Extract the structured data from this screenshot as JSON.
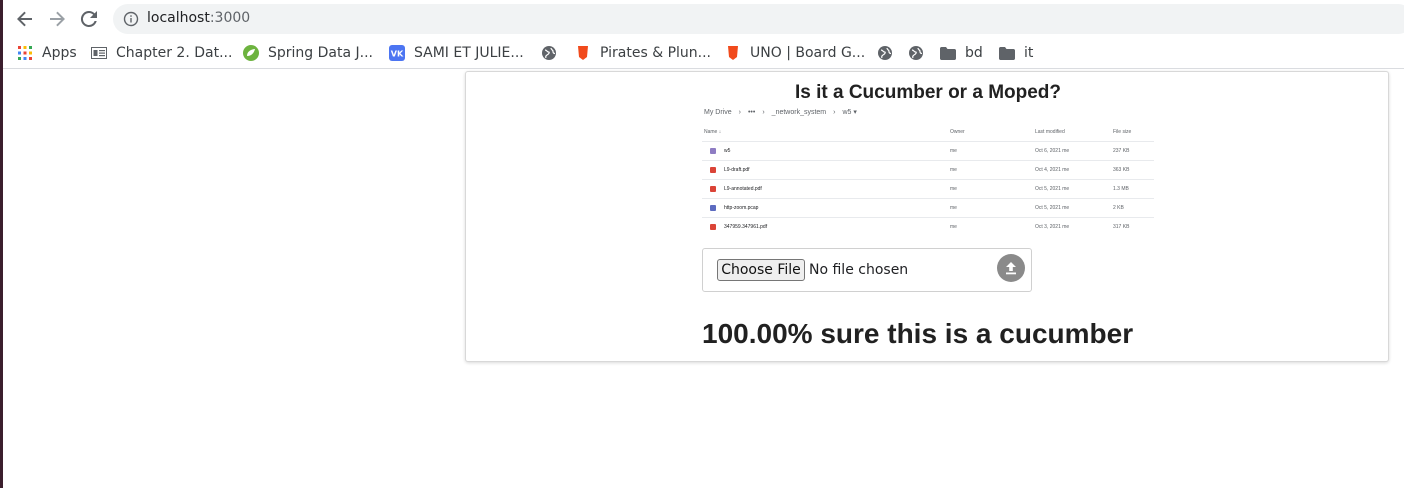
{
  "browser": {
    "url_host": "localhost",
    "url_port": ":3000"
  },
  "bookmarks": [
    {
      "label": "Apps",
      "icon": "apps-grid-icon"
    },
    {
      "label": "Chapter 2. Dat...",
      "icon": "reader-icon"
    },
    {
      "label": "Spring Data J...",
      "icon": "spring-leaf-icon"
    },
    {
      "label": "SAMI ET JULIE...",
      "icon": "vk-icon"
    },
    {
      "label": "",
      "icon": "globe-icon"
    },
    {
      "label": "Pirates & Plun...",
      "icon": "shield-orange-icon"
    },
    {
      "label": "UNO | Board G...",
      "icon": "shield-orange-icon"
    },
    {
      "label": "",
      "icon": "globe-icon"
    },
    {
      "label": "",
      "icon": "globe-icon"
    },
    {
      "label": "bd",
      "icon": "folder-icon"
    },
    {
      "label": "it",
      "icon": "folder-icon"
    }
  ],
  "card": {
    "title": "Is it a Cucumber or a Moped?",
    "result": "100.00% sure this is a cucumber"
  },
  "preview": {
    "breadcrumb": [
      "My Drive",
      "›",
      "•••",
      "›",
      "_network_system",
      "›",
      "w5 ▾"
    ],
    "headers": {
      "name": "Name ↓",
      "owner": "Owner",
      "modified": "Last modified",
      "size": "File size"
    },
    "rows": [
      {
        "name": "w5",
        "owner": "me",
        "modified": "Oct 6, 2021 me",
        "size": "237 KB",
        "color": "#8e7cc3"
      },
      {
        "name": "L9-draft.pdf",
        "owner": "me",
        "modified": "Oct 4, 2021 me",
        "size": "363 KB",
        "color": "#db4437"
      },
      {
        "name": "L9-annotated.pdf",
        "owner": "me",
        "modified": "Oct 5, 2021 me",
        "size": "1.3 MB",
        "color": "#db4437"
      },
      {
        "name": "http-zoom.pcap",
        "owner": "me",
        "modified": "Oct 5, 2021 me",
        "size": "2 KB",
        "color": "#5c6bc0"
      },
      {
        "name": "347959.347961.pdf",
        "owner": "me",
        "modified": "Oct 3, 2021 me",
        "size": "317 KB",
        "color": "#db4437"
      }
    ]
  },
  "upload": {
    "choose_label": "Choose File",
    "status": "No file chosen"
  }
}
